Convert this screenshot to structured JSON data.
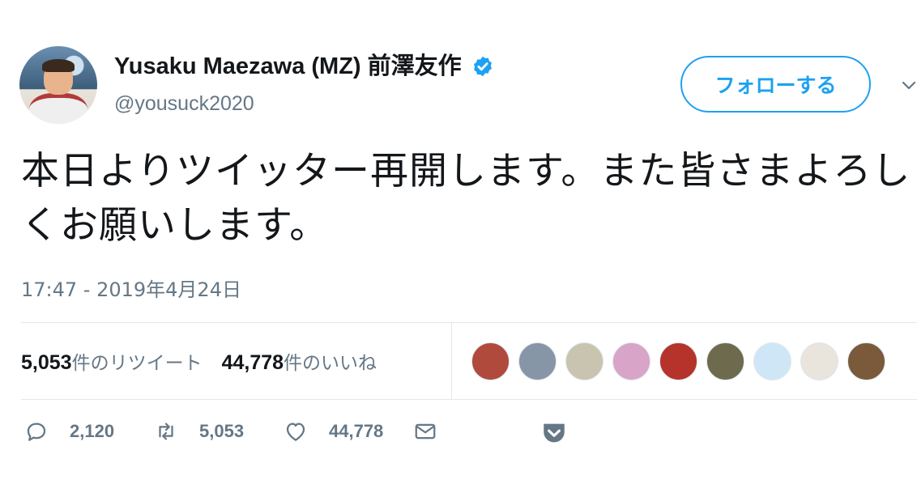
{
  "user": {
    "name": "Yusaku Maezawa (MZ) 前澤友作",
    "handle": "@yousuck2020"
  },
  "follow_button": {
    "label": "フォローする"
  },
  "tweet": {
    "text": "本日よりツイッター再開します。また皆さまよろしくお願いします。",
    "timestamp": "17:47 - 2019年4月24日"
  },
  "stats": {
    "retweets_count": "5,053",
    "retweets_label": "件のリツイート",
    "likes_count": "44,778",
    "likes_label": "件のいいね"
  },
  "likers": [
    {
      "name": "liker-avatar-1",
      "color": "#b04a3c"
    },
    {
      "name": "liker-avatar-2",
      "color": "#8796a6"
    },
    {
      "name": "liker-avatar-3",
      "color": "#c9c4b0"
    },
    {
      "name": "liker-avatar-4",
      "color": "#d8a4c8"
    },
    {
      "name": "liker-avatar-5",
      "color": "#b5332b"
    },
    {
      "name": "liker-avatar-6",
      "color": "#6e6a4e"
    },
    {
      "name": "liker-avatar-7",
      "color": "#cfe6f7"
    },
    {
      "name": "liker-avatar-8",
      "color": "#e9e4dc"
    },
    {
      "name": "liker-avatar-9",
      "color": "#7a5a3a"
    }
  ],
  "actions": {
    "reply_count": "2,120",
    "retweet_count": "5,053",
    "like_count": "44,778"
  },
  "colors": {
    "accent": "#1da1f2",
    "secondary_text": "#657786",
    "primary_text": "#14171a",
    "divider": "#e1e8ed"
  }
}
